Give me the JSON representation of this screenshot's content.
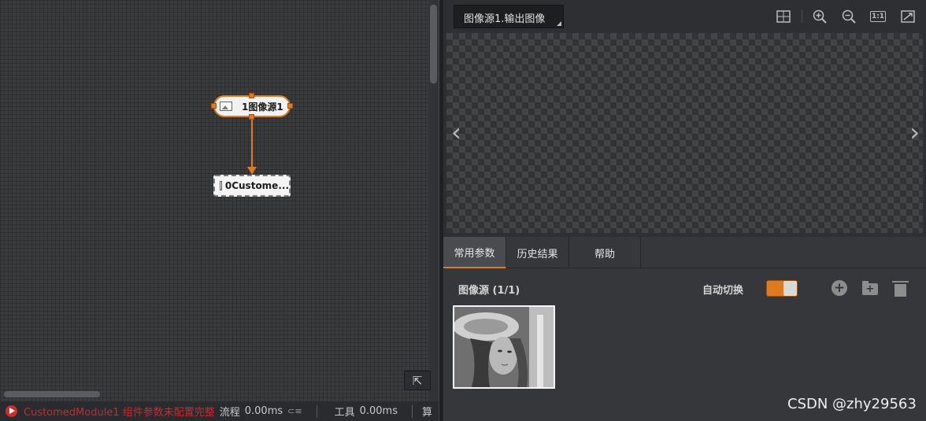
{
  "flow": {
    "node_source": "1图像源1",
    "node_custom": "0Custome...",
    "expand_glyph": "⇱"
  },
  "status": {
    "error_text": "CustomedModule1 组件参数未配置完整",
    "flow_label": "流程",
    "flow_time": "0.00ms",
    "tool_label": "工具",
    "tool_time": "0.00ms",
    "algo_label": "算"
  },
  "viewer": {
    "selected_image": "图像源1.输出图像",
    "zoom_fit_label": "1:1"
  },
  "panel": {
    "tabs": [
      "常用参数",
      "历史结果",
      "帮助"
    ],
    "source_title": "图像源 (1/1)",
    "auto_switch_label": "自动切换",
    "auto_switch_on": true
  },
  "watermark": "CSDN @zhy29563",
  "colors": {
    "accent": "#e07a1f",
    "error": "#c22d2d"
  },
  "icons": [
    "grid-icon",
    "zoom-in-icon",
    "zoom-out-icon",
    "actual-size-icon",
    "fit-icon",
    "add-icon",
    "folder-icon",
    "trash-icon",
    "image-icon",
    "run-error-icon"
  ]
}
